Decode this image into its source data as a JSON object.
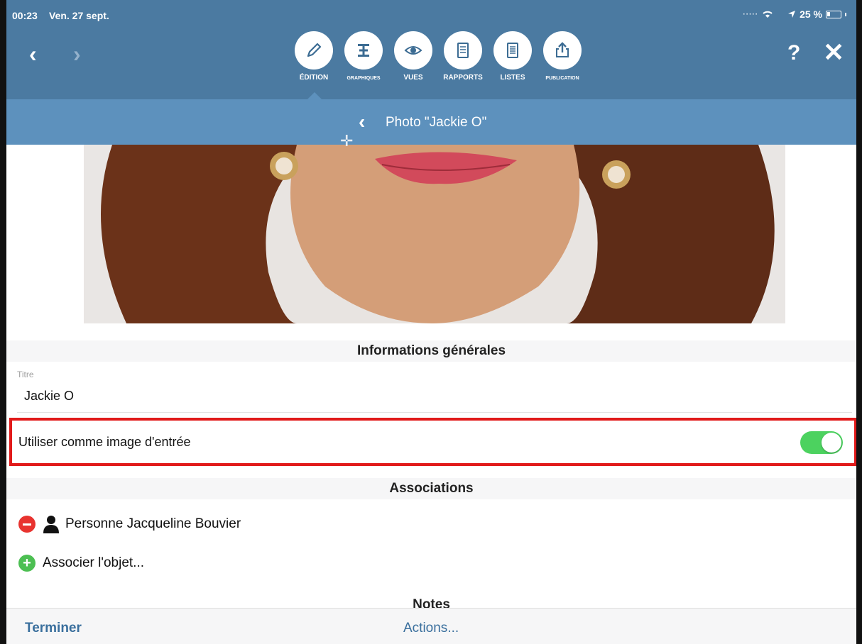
{
  "status_bar": {
    "time": "00:23",
    "date": "Ven. 27 sept.",
    "battery": "25 %",
    "battery_level": 0.25
  },
  "nav": {
    "back_icon": "chevron-left-icon",
    "forward_icon": "chevron-right-icon",
    "help_label": "?",
    "close_icon": "close-icon"
  },
  "tabs": [
    {
      "label": "ÉDITION",
      "icon": "pencil-icon",
      "active": true
    },
    {
      "label": "GRAPHIQUES",
      "icon": "chart-icon",
      "active": false
    },
    {
      "label": "VUES",
      "icon": "eye-icon",
      "active": false
    },
    {
      "label": "RAPPORTS",
      "icon": "report-icon",
      "active": false
    },
    {
      "label": "LISTES",
      "icon": "list-icon",
      "active": false
    },
    {
      "label": "PUBLICATION",
      "icon": "upload-icon",
      "active": false
    }
  ],
  "subheader": {
    "title": "Photo  \"Jackie O\""
  },
  "sections": {
    "general": "Informations générales",
    "associations": "Associations",
    "notes": "Notes"
  },
  "title_field": {
    "label": "Titre",
    "value": "Jackie O"
  },
  "entry_image": {
    "label": "Utiliser comme image d'entrée",
    "enabled": true
  },
  "associations": [
    {
      "label": "Personne Jacqueline Bouvier",
      "icon": "person-icon"
    }
  ],
  "add_association": "Associer l'objet...",
  "bottom": {
    "done": "Terminer",
    "actions": "Actions..."
  },
  "colors": {
    "header": "#4b7aa1",
    "subheader": "#5d91bd",
    "highlight": "#e11a1a",
    "toggle_on": "#4cd25f",
    "link": "#3a6f9d"
  }
}
